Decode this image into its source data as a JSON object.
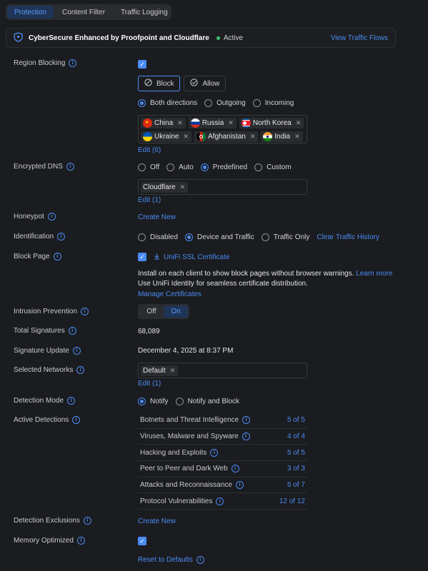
{
  "tabs": [
    {
      "label": "Protection",
      "active": true
    },
    {
      "label": "Content Filter",
      "active": false
    },
    {
      "label": "Traffic Logging",
      "active": false
    }
  ],
  "banner": {
    "title": "CyberSecure Enhanced by Proofpoint and Cloudflare",
    "status": "Active",
    "link": "View Traffic Flows"
  },
  "region_blocking": {
    "label": "Region Blocking",
    "enabled": true,
    "mode_block": "Block",
    "mode_allow": "Allow",
    "dir_both": "Both directions",
    "dir_out": "Outgoing",
    "dir_in": "Incoming",
    "countries": [
      {
        "name": "China",
        "flag": "china-flag-icon"
      },
      {
        "name": "Russia",
        "flag": "russia-flag-icon"
      },
      {
        "name": "North Korea",
        "flag": "north-korea-flag-icon"
      },
      {
        "name": "Ukraine",
        "flag": "ukraine-flag-icon"
      },
      {
        "name": "Afghanistan",
        "flag": "afghanistan-flag-icon"
      },
      {
        "name": "India",
        "flag": "india-flag-icon"
      }
    ],
    "edit": "Edit (6)"
  },
  "encrypted_dns": {
    "label": "Encrypted DNS",
    "opt_off": "Off",
    "opt_auto": "Auto",
    "opt_predefined": "Predefined",
    "opt_custom": "Custom",
    "server": "Cloudflare",
    "edit": "Edit (1)"
  },
  "honeypot": {
    "label": "Honeypot",
    "action": "Create New"
  },
  "identification": {
    "label": "Identification",
    "opt_disabled": "Disabled",
    "opt_device": "Device and Traffic",
    "opt_traffic": "Traffic Only",
    "clear": "Clear Traffic History"
  },
  "block_page": {
    "label": "Block Page",
    "cert": "UniFi SSL Certificate",
    "desc1": "Install on each client to show block pages without browser warnings.",
    "learn": "Learn more",
    "desc2": "Use UniFi Identity for seamless certificate distribution.",
    "manage": "Manage Certificates"
  },
  "ips": {
    "label": "Intrusion Prevention",
    "off": "Off",
    "on": "On"
  },
  "total_signatures": {
    "label": "Total Signatures",
    "value": "68,089"
  },
  "signature_update": {
    "label": "Signature Update",
    "value": "December 4, 2025 at 8:37 PM"
  },
  "selected_networks": {
    "label": "Selected Networks",
    "network": "Default",
    "edit": "Edit (1)"
  },
  "detection_mode": {
    "label": "Detection Mode",
    "opt_notify": "Notify",
    "opt_block": "Notify and Block"
  },
  "active_detections": {
    "label": "Active Detections",
    "rows": [
      {
        "name": "Botnets and Threat Intelligence",
        "value": "5 of 5"
      },
      {
        "name": "Viruses, Malware and Spyware",
        "value": "4 of 4"
      },
      {
        "name": "Hacking and Exploits",
        "value": "5 of 5"
      },
      {
        "name": "Peer to Peer and Dark Web",
        "value": "3 of 3"
      },
      {
        "name": "Attacks and Reconnaissance",
        "value": "6 of 7"
      },
      {
        "name": "Protocol Vulnerabilities",
        "value": "12 of 12"
      }
    ]
  },
  "detection_exclusions": {
    "label": "Detection Exclusions",
    "action": "Create New"
  },
  "memory_optimized": {
    "label": "Memory Optimized",
    "enabled": true
  },
  "reset": "Reset to Defaults",
  "colors": {
    "accent": "#4a8cf5",
    "background": "#1b1c1f",
    "active_dot": "#3cc46e"
  }
}
